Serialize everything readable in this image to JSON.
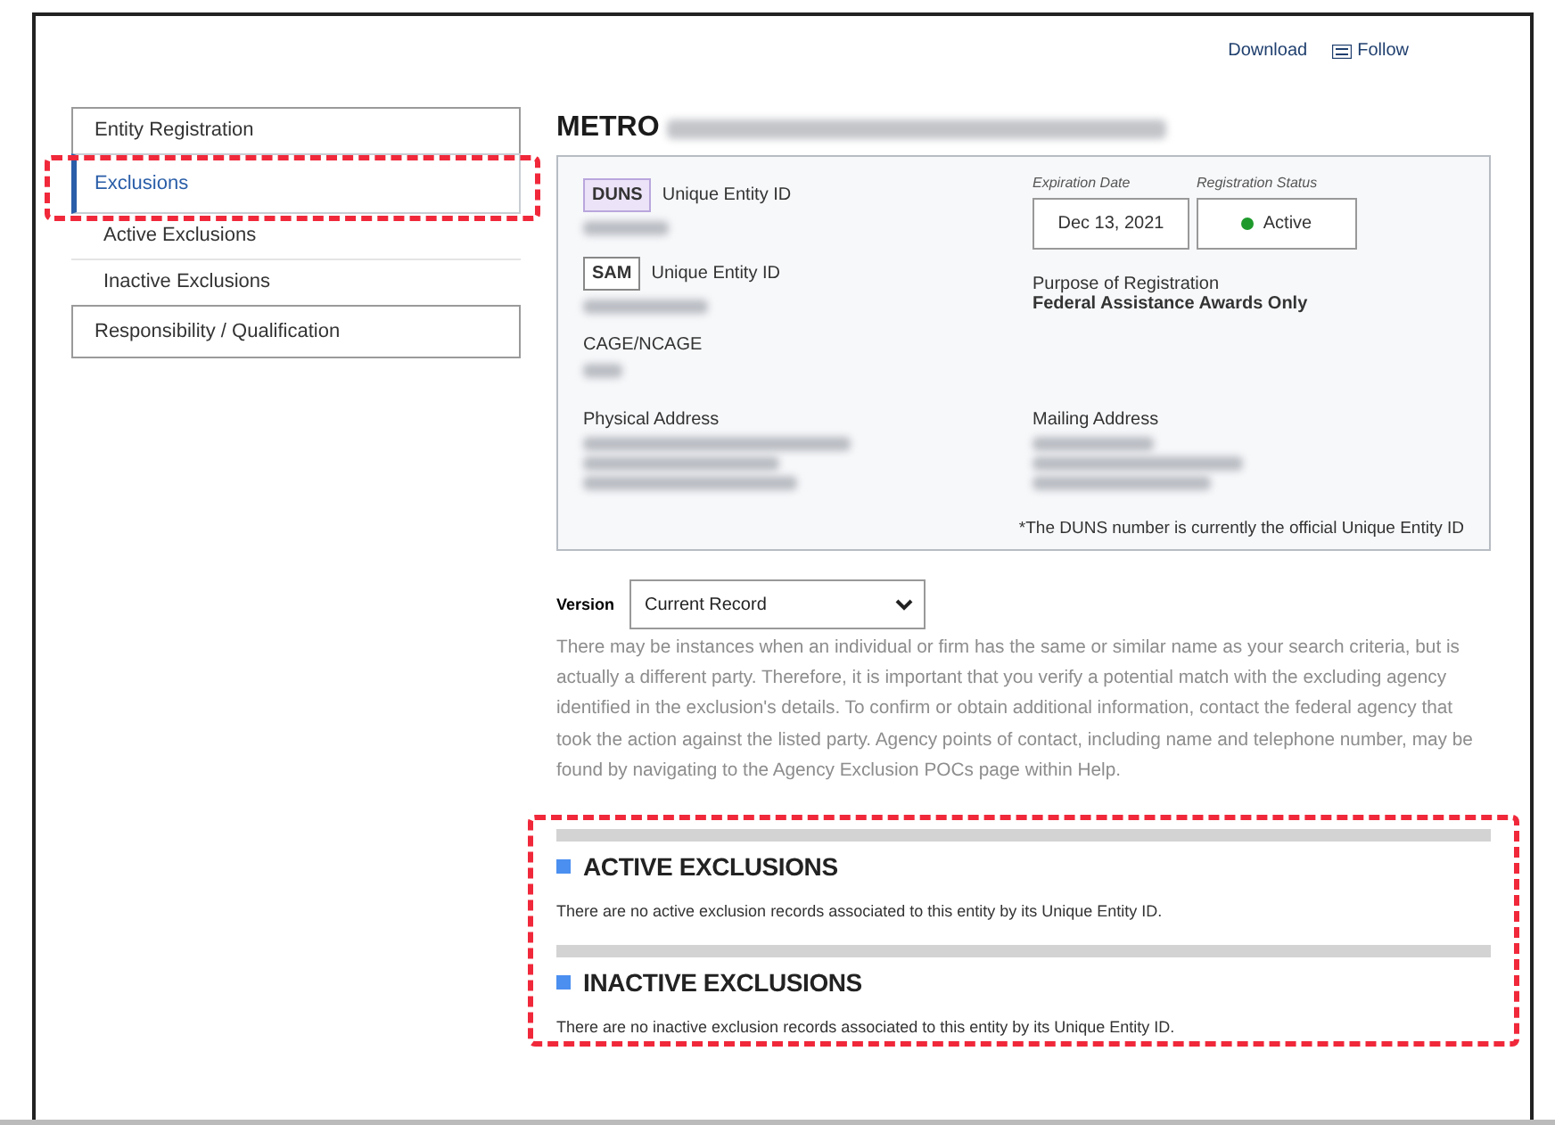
{
  "header_actions": [
    {
      "kind": "link",
      "label": "Download"
    },
    {
      "kind": "icon-link",
      "label": "Follow"
    }
  ],
  "sidebar": {
    "items": [
      {
        "label": "Entity Registration",
        "selected": false,
        "highlighted": false
      },
      {
        "label": "Exclusions",
        "selected": true,
        "highlighted": true,
        "children": [
          {
            "label": "Active Exclusions",
            "selected": false
          },
          {
            "label": "Inactive Exclusions",
            "selected": false
          }
        ]
      },
      {
        "label": "Responsibility / Qualification",
        "selected": false,
        "highlighted": false
      }
    ]
  },
  "entity": {
    "name": "METRO",
    "name_redacted": true,
    "ids": [
      {
        "badge": "DUNS",
        "label": "Unique Entity ID",
        "color": "#ece3f8",
        "redacted": true
      },
      {
        "badge": "SAM",
        "label": "Unique Entity ID",
        "color": "#ffffff",
        "redacted": true
      }
    ],
    "cage": {
      "label": "CAGE/NCAGE",
      "redacted": true
    },
    "expiration": {
      "label": "Expiration Date",
      "value": "Dec 13, 2021"
    },
    "status": {
      "label": "Registration Status",
      "value": "Active",
      "color": "#1e9a2c"
    },
    "purpose": {
      "label": "Purpose of Registration",
      "value": "Federal Assistance Awards Only"
    },
    "addresses": [
      {
        "label": "Physical Address",
        "redacted": true
      },
      {
        "label": "Mailing Address",
        "redacted": true
      }
    ],
    "footnote": "*The DUNS number is currently the official Unique Entity ID"
  },
  "version": {
    "label": "Version",
    "value": "Current Record"
  },
  "notice": "There may be instances when an individual or firm has the same or similar name as your search criteria, but is actually a different party. Therefore, it is important that you verify a potential match with the excluding agency identified in the exclusion's details. To confirm or obtain additional information, contact the federal agency that took the action against the listed party. Agency points of contact, including name and telephone number, may be found by navigating to the Agency Exclusion POCs page within Help.",
  "sections_highlighted": true,
  "sections": [
    {
      "title": "ACTIVE EXCLUSIONS",
      "message": "There are no active exclusion records associated to this entity by its Unique Entity ID."
    },
    {
      "title": "INACTIVE EXCLUSIONS",
      "message": "There are no inactive exclusion records associated to this entity by its Unique Entity ID."
    }
  ]
}
